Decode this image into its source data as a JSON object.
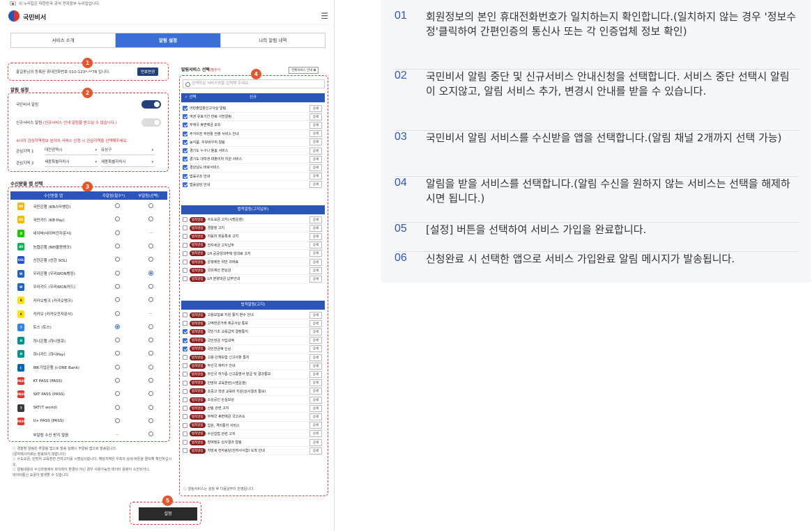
{
  "top_notice": "이 누리집은 대한민국 공식 전자정부 누리집입니다.",
  "brand": "국민비서",
  "tabs": [
    "서비스 소개",
    "알림 설정",
    "나의 알림 내역"
  ],
  "phone": {
    "text": "홍길동님의 등록된 휴대전화번호 010-123*-**78 입니다.",
    "button": "번호변경"
  },
  "alarm": {
    "title": "알림 설정",
    "kukmin_label": "국민비서 알림",
    "kukmin_on": true,
    "new_label": "신규서비스 알림",
    "new_note": "(신규서비스 안내 알림을 받으실 수 없습니다.)",
    "new_on": false,
    "interest_notice": "※나의 관심지역정보 분야의 서비스 신청 시 관심지역을 선택해주세요.",
    "region1_label": "관심지역 1",
    "region1": [
      "대전광역시",
      "유성구"
    ],
    "region2_label": "관심지역 2",
    "region2": [
      "세종특별자치시",
      "세종특별자치시"
    ]
  },
  "apps": {
    "title": "수신받을 앱 선택",
    "headers": [
      "수신받을 앱",
      "주알림(필수*)",
      "부알림(선택)"
    ],
    "rows": [
      {
        "name": "국민은행 (KB스타뱅킹)",
        "icon": "KB",
        "color": "#f6b900",
        "main": "off",
        "sub": "off"
      },
      {
        "name": "국민카드 (KB Pay)",
        "icon": "KB",
        "color": "#f6b900",
        "main": "off",
        "sub": "off"
      },
      {
        "name": "네이버(네이버전자문서)",
        "icon": "N",
        "color": "#1ec800",
        "main": "off",
        "sub": "dash"
      },
      {
        "name": "농협은행 (NH올원뱅크)",
        "icon": "All",
        "color": "#0bb35a",
        "main": "off",
        "sub": "off"
      },
      {
        "name": "신한은행 (신한 SOL)",
        "icon": "SOL",
        "color": "#1a4fd6",
        "main": "off",
        "sub": "off"
      },
      {
        "name": "우리은행 (우리WON뱅킹)",
        "icon": "W",
        "color": "#1e64c8",
        "main": "off",
        "sub": "on"
      },
      {
        "name": "우리카드 (우리WON카드)",
        "icon": "W",
        "color": "#1e64c8",
        "main": "off",
        "sub": "off"
      },
      {
        "name": "카카오뱅크 (카카오뱅크)",
        "icon": "B",
        "color": "#fee500",
        "main": "off",
        "sub": "off"
      },
      {
        "name": "카카오 (카카오전자문서)",
        "icon": "K",
        "color": "#fee500",
        "main": "off",
        "sub": "dash"
      },
      {
        "name": "토스 (토스)",
        "icon": "T",
        "color": "#3182f6",
        "main": "on",
        "sub": "off"
      },
      {
        "name": "하나은행 (하나원큐)",
        "icon": "H",
        "color": "#009490",
        "main": "off",
        "sub": "off"
      },
      {
        "name": "하나카드 (하나Pay)",
        "icon": "H",
        "color": "#009490",
        "main": "off",
        "sub": "off"
      },
      {
        "name": "IBK기업은행 (i-ONE Bank)",
        "icon": "i-ONE",
        "color": "#0068b7",
        "main": "off",
        "sub": "off"
      },
      {
        "name": "KT PASS (PASS)",
        "icon": "PASS",
        "color": "#e8352b",
        "main": "off",
        "sub": "off"
      },
      {
        "name": "SKT PASS (PASS)",
        "icon": "PASS",
        "color": "#e8352b",
        "main": "off",
        "sub": "off"
      },
      {
        "name": "SKT(T world)",
        "icon": "T",
        "color": "#3b3b3b",
        "main": "off",
        "sub": "off"
      },
      {
        "name": "U+ PASS (PASS)",
        "icon": "PASS",
        "color": "#e8352b",
        "main": "off",
        "sub": "off"
      },
      {
        "name": "부알림 수신 받지 않음",
        "icon": "",
        "color": "#ffffff",
        "main": "dash",
        "sub": "off"
      }
    ]
  },
  "notes": [
    "ⓘ 경찰청 알림은 주알림 앱으로 발송 실패시 부알림 앱으로 발송됩니다.",
    "(문자메시지로는 발송되지 않습니다)",
    "ⓘ 수도요금, 민방위 교육훈련 전자고지를 시범실시합니다. 해당지역은 우측의 상세 버튼을 클릭해 확인하십시오.",
    "ⓘ 알림내용의 수신과정에서 와이파이 환경이 아닌 경우 사용가능한 데이터 용량이 소진되거나,",
    "데이터통신 요금이 발생할 수 있습니다."
  ],
  "services": {
    "title": "알림서비스 선택",
    "required": "(필수*)",
    "guide_button": "전체서비스 안내",
    "search_placeholder": "검색하실 서비스명을 입력해 주세요.",
    "select_label": "선택",
    "new_head": "신규",
    "new_rows": [
      {
        "name": "어린출입항신고사실 알림",
        "checked": true
      },
      {
        "name": "여권 유효기간 만료 사전알림",
        "checked": true
      },
      {
        "name": "부재국 휴면예금 보유",
        "checked": true
      },
      {
        "name": "주거이전 무현활 전출 서비스 안내",
        "checked": true
      },
      {
        "name": "농식품, 우유바우처 알림",
        "checked": true
      },
      {
        "name": "경기도 누구나 돌봄 서비스",
        "checked": true
      },
      {
        "name": "경기도 대학생 대출이자 지원 서비스",
        "checked": true
      },
      {
        "name": "경상남도 바로서비스",
        "checked": true
      },
      {
        "name": "법률구조 안내",
        "checked": true
      },
      {
        "name": "법률상담 안내",
        "checked": true
      }
    ],
    "notice_head": "법적알림(고지납부)",
    "notice_rows": [
      {
        "name": "수도요금 고지(시범운영)",
        "checked": false
      },
      {
        "name": "경찰청 고지",
        "checked": false
      },
      {
        "name": "자동차 취등록세 고지",
        "checked": false
      },
      {
        "name": "전자세금 고지납부",
        "checked": false
      },
      {
        "name": "LH 공공임대주택 임대료 고지",
        "checked": false
      },
      {
        "name": "운행제한 위반 과태료",
        "checked": false
      },
      {
        "name": "국유재산 변상금",
        "checked": false
      },
      {
        "name": "LH 분양대금 납부안내",
        "checked": false
      }
    ],
    "legal_head": "법적알림(고지)",
    "legal_rows": [
      {
        "name": "고용보험료 지원 통지 환수 안내",
        "checked": false
      },
      {
        "name": "고액현금거래 제공사실 통보",
        "checked": false
      },
      {
        "name": "국민기초 교육급여 결정통지",
        "checked": true
      },
      {
        "name": "국민연금 가입내역",
        "checked": true
      },
      {
        "name": "국민연금액 인상",
        "checked": true
      },
      {
        "name": "고용·산재보험 신고사항 통지",
        "checked": false
      },
      {
        "name": "무선국 재허가 안내",
        "checked": false
      },
      {
        "name": "무선국 허가증·신고증명서 발급 및 결과통보",
        "checked": false
      },
      {
        "name": "민방위 교육훈련(시범운영)",
        "checked": false
      },
      {
        "name": "초중고 학생 교육비 지원(심사결과 통보)",
        "checked": false
      },
      {
        "name": "소상공인 손실보상",
        "checked": false
      },
      {
        "name": "산림 관련 고지",
        "checked": false
      },
      {
        "name": "부재국 휴면예금 국고귀속",
        "checked": false
      },
      {
        "name": "입원, 격리통지 서비스",
        "checked": false
      },
      {
        "name": "수산업법 관련 고지",
        "checked": false
      },
      {
        "name": "장애정도 심사결과 알림",
        "checked": false
      },
      {
        "name": "지방세 전자송달(전자사서함) 도착 안내",
        "checked": false
      }
    ],
    "badge": "법적알림",
    "detail": "상세",
    "footer": "ⓘ 알림서비스는 설정 후 다음날부터 반영됩니다."
  },
  "set_button": "설정",
  "markers": [
    "1",
    "2",
    "3",
    "4",
    "5"
  ],
  "steps": [
    {
      "num": "01",
      "text": "회원정보의 본인 휴대전화번호가 일치하는지 확인합니다.(일치하지 않는 경우 '정보수정'클릭하여 간편인증의 통신사 또는 각 인증업체 정보 확인)"
    },
    {
      "num": "02",
      "text": "국민비서 알림 중단 및 신규서비스 안내신청을 선택합니다. 서비스 중단 선택시 알림이 오지않고, 알림 서비스 추가, 변경시 안내를 받을 수 있습니다."
    },
    {
      "num": "03",
      "text": "국민비서 알림 서비스를 수신받을 앱을 선택합니다.(알림 채널 2개까지 선택 가능)"
    },
    {
      "num": "04",
      "text": "알림을 받을 서비스를 선택합니다.(알림 수신을 원하지 않는 서비스는 선택을 해제하시면 됩니다.)"
    },
    {
      "num": "05",
      "text": "[설정] 버튼을 선택하여 서비스 가입을 완료합니다."
    },
    {
      "num": "06",
      "text": "신청완료 시 선택한 앱으로 서비스 가입완료 알림 메시지가 발송됩니다."
    }
  ]
}
